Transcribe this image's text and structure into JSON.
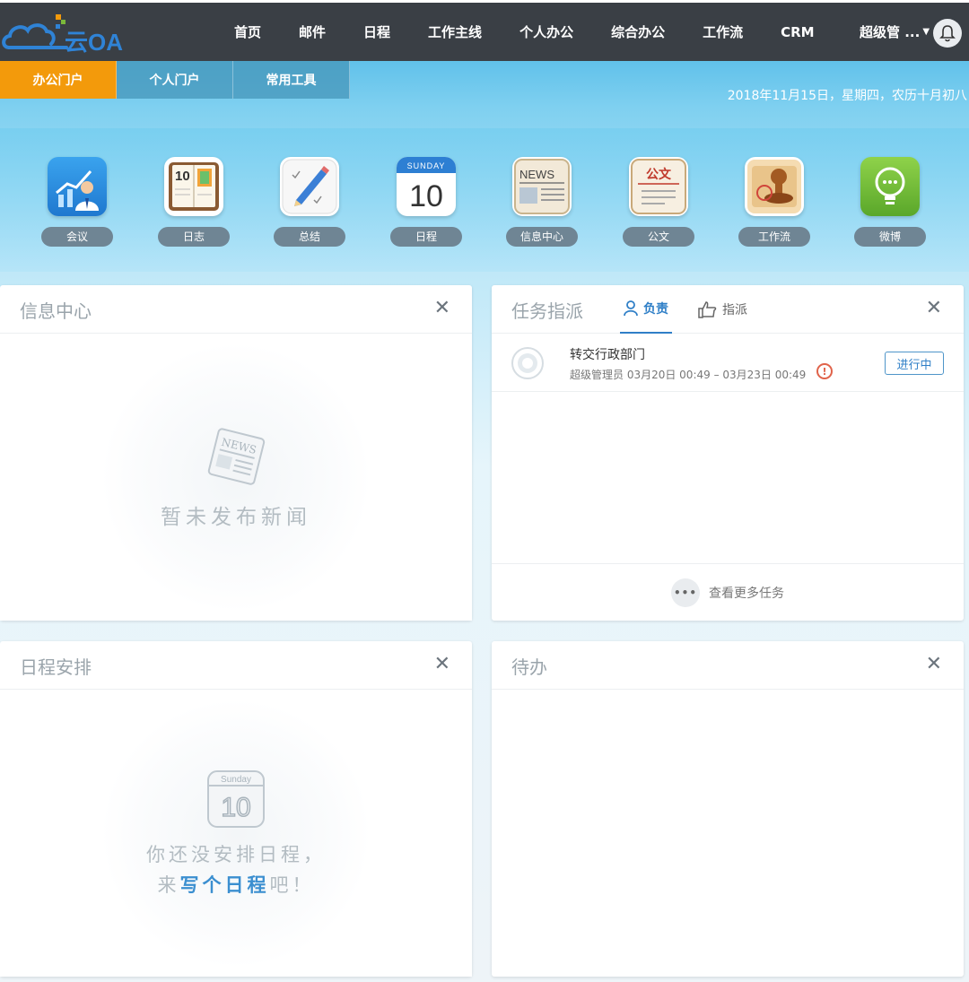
{
  "brand": {
    "logo_text": "云OA"
  },
  "nav": {
    "items": [
      "首页",
      "邮件",
      "日程",
      "工作主线",
      "个人办公",
      "综合办公",
      "工作流",
      "CRM"
    ],
    "user": "超级管 ..."
  },
  "portal": {
    "tabs": [
      "办公门户",
      "个人门户",
      "常用工具"
    ],
    "active": "办公门户",
    "date": "2018年11月15日，星期四，农历十月初八"
  },
  "apps": [
    {
      "label": "会议",
      "icon": "meeting-icon"
    },
    {
      "label": "日志",
      "icon": "diary-icon"
    },
    {
      "label": "总结",
      "icon": "summary-icon"
    },
    {
      "label": "日程",
      "icon": "calendar-icon"
    },
    {
      "label": "信息中心",
      "icon": "news-icon"
    },
    {
      "label": "公文",
      "icon": "document-icon"
    },
    {
      "label": "工作流",
      "icon": "stamp-icon"
    },
    {
      "label": "微博",
      "icon": "lightbulb-icon"
    }
  ],
  "app_icon_text": {
    "diary_num": "10",
    "calendar_day": "SUNDAY",
    "calendar_num": "10",
    "news": "NEWS",
    "document": "公文"
  },
  "panels": {
    "news": {
      "title": "信息中心",
      "empty_icon_text": "NEWS",
      "empty_text": "暂未发布新闻"
    },
    "tasks": {
      "title": "任务指派",
      "tabs": [
        "负责",
        "指派"
      ],
      "items": [
        {
          "title": "转交行政部门",
          "meta": "超级管理员 03月20日 00:49 – 03月23日 00:49",
          "status": "进行中"
        }
      ],
      "more": "查看更多任务"
    },
    "schedule": {
      "title": "日程安排",
      "icon_day": "Sunday",
      "icon_num": "10",
      "line1": "你还没安排日程，",
      "line2_pre": "来",
      "line2_hl": "写个日程",
      "line2_post": "吧！"
    },
    "todo": {
      "title": "待办"
    }
  },
  "colors": {
    "topbar": "#3a3f45",
    "active_tab": "#f39a0b",
    "accent": "#2f7fc7",
    "warning": "#e0634a"
  }
}
